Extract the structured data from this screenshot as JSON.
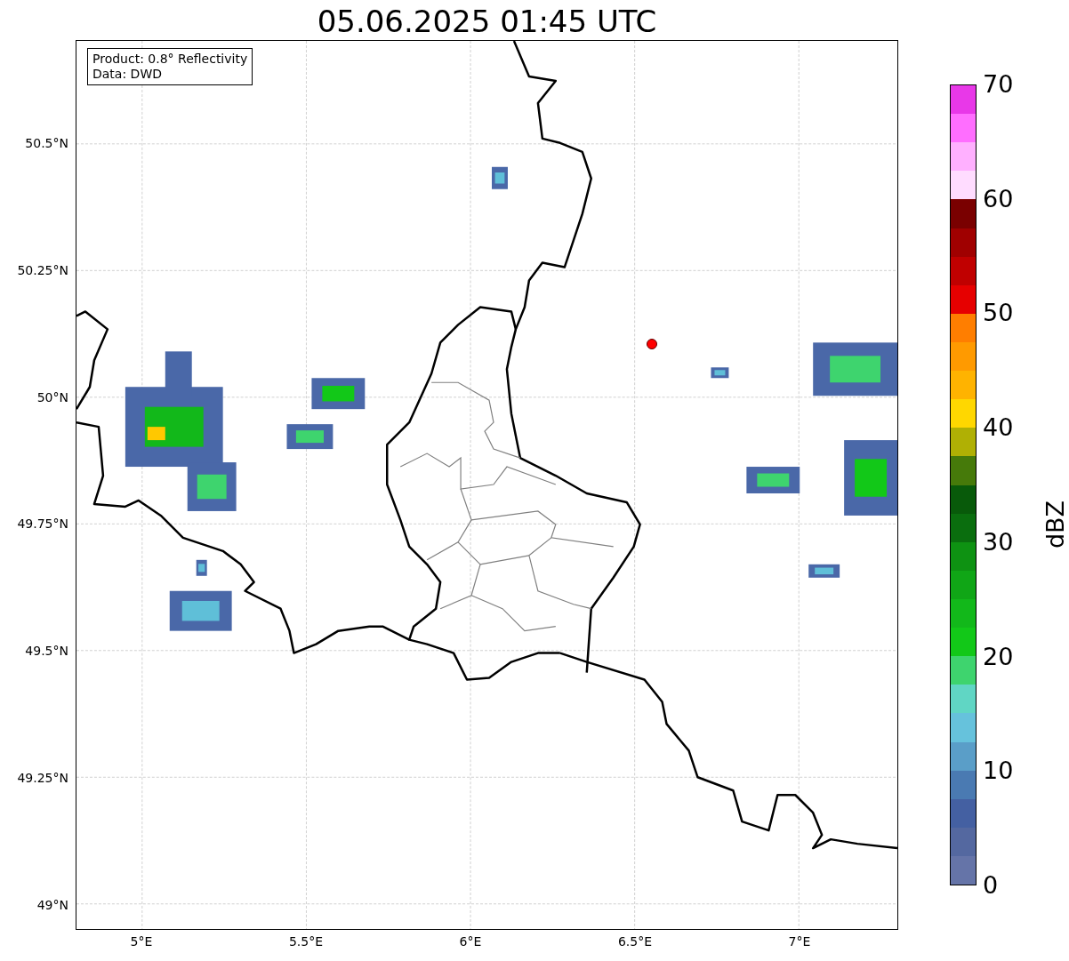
{
  "title": "05.06.2025 01:45 UTC",
  "legend": {
    "lines": [
      "Product: 0.8° Reflectivity",
      "Data: DWD"
    ]
  },
  "lat_ticks": [
    "50.5°N",
    "50.25°N",
    "50°N",
    "49.75°N",
    "49.5°N",
    "49.25°N",
    "49°N"
  ],
  "lon_ticks": [
    "5°E",
    "5.5°E",
    "6°E",
    "6.5°E",
    "7°E"
  ],
  "colorbar": {
    "label": "dBZ",
    "ticks": [
      "70",
      "60",
      "50",
      "40",
      "30",
      "20",
      "10",
      "0"
    ],
    "bins": [
      {
        "color": "#e838e8"
      },
      {
        "color": "#ff6eff"
      },
      {
        "color": "#ffb0ff"
      },
      {
        "color": "#ffdcff"
      },
      {
        "color": "#7a0000"
      },
      {
        "color": "#a00000"
      },
      {
        "color": "#c00000"
      },
      {
        "color": "#e60000"
      },
      {
        "color": "#ff7e00"
      },
      {
        "color": "#ff9a00"
      },
      {
        "color": "#ffb300"
      },
      {
        "color": "#ffd700"
      },
      {
        "color": "#b0b004"
      },
      {
        "color": "#467a0a"
      },
      {
        "color": "#085a0a"
      },
      {
        "color": "#0a6e0e"
      },
      {
        "color": "#0e9212"
      },
      {
        "color": "#10a616"
      },
      {
        "color": "#12b81a"
      },
      {
        "color": "#12c818"
      },
      {
        "color": "#3ed46e"
      },
      {
        "color": "#60d6c4"
      },
      {
        "color": "#66c2dc"
      },
      {
        "color": "#5a9ec8"
      },
      {
        "color": "#4a7ab2"
      },
      {
        "color": "#4460a2"
      },
      {
        "color": "#5468a0"
      },
      {
        "color": "#6574a8"
      }
    ]
  }
}
